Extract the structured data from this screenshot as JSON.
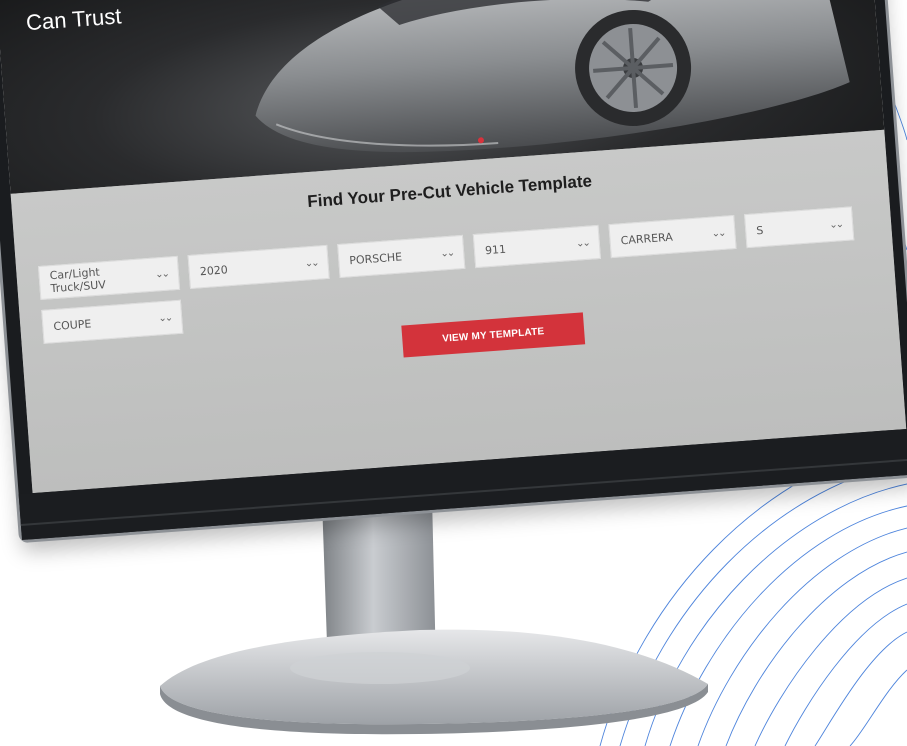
{
  "hero": {
    "title": "Can Trust"
  },
  "finder": {
    "heading": "Find Your Pre-Cut Vehicle Template",
    "selects": [
      {
        "value": "Car/Light Truck/SUV"
      },
      {
        "value": "2020"
      },
      {
        "value": "PORSCHE"
      },
      {
        "value": "911"
      },
      {
        "value": "CARRERA"
      },
      {
        "value": "S"
      },
      {
        "value": "COUPE"
      }
    ],
    "submit_label": "VIEW MY TEMPLATE"
  },
  "colors": {
    "accent": "#d3333b",
    "hero_bg": "#1a1b1d",
    "form_bg": "#c3c4c3",
    "line_art": "#2f6fd6"
  },
  "icons": [
    "chevron-down-icon",
    "slider-dot-indicator"
  ]
}
